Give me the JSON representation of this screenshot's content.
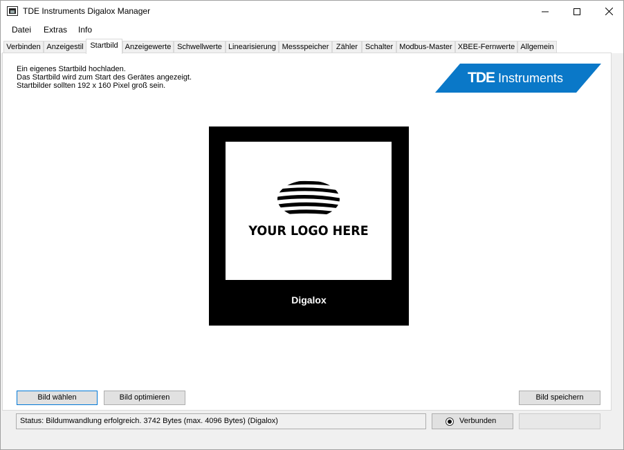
{
  "window": {
    "title": "TDE Instruments Digalox Manager"
  },
  "menu": {
    "items": [
      "Datei",
      "Extras",
      "Info"
    ]
  },
  "tabs": [
    {
      "label": "Verbinden",
      "active": false
    },
    {
      "label": "Anzeigestil",
      "active": false
    },
    {
      "label": "Startbild",
      "active": true
    },
    {
      "label": "Anzeigewerte",
      "active": false
    },
    {
      "label": "Schwellwerte",
      "active": false
    },
    {
      "label": "Linearisierung",
      "active": false
    },
    {
      "label": "Messspeicher",
      "active": false
    },
    {
      "label": "Zähler",
      "active": false
    },
    {
      "label": "Schalter",
      "active": false
    },
    {
      "label": "Modbus-Master",
      "active": false
    },
    {
      "label": "XBEE-Fernwerte",
      "active": false
    },
    {
      "label": "Allgemein",
      "active": false
    }
  ],
  "startbild": {
    "description": [
      "Ein eigenes Startbild hochladen.",
      "Das Startbild wird zum Start des Gerätes angezeigt.",
      "Startbilder sollten 192 x 160 Pixel groß sein."
    ],
    "brand_logo": {
      "bold": "TDE",
      "rest": " Instruments",
      "color": "#0a78c8"
    },
    "preview": {
      "logo_text": "YOUR LOGO HERE",
      "caption": "Digalox"
    },
    "buttons": {
      "choose": "Bild wählen",
      "optimize": "Bild optimieren",
      "save": "Bild speichern"
    }
  },
  "status": {
    "text": "Status: Bildumwandlung erfolgreich. 3742 Bytes (max. 4096 Bytes) (Digalox)",
    "connection_label": "Verbunden",
    "connected": true
  }
}
